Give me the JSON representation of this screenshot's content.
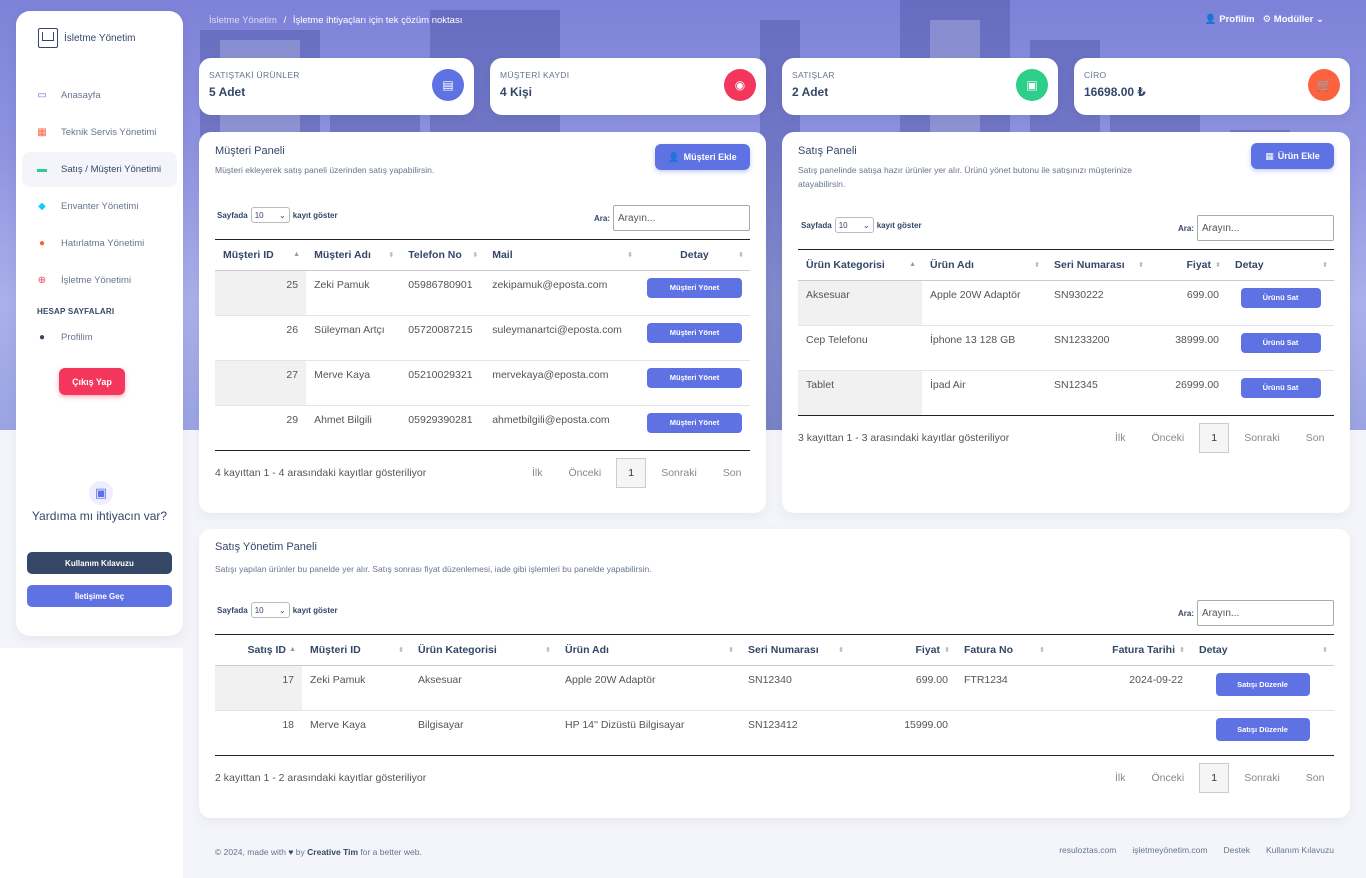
{
  "sidebar": {
    "brand": "İsletme Yönetim",
    "items": [
      {
        "label": "Anasayfa",
        "icon": "monitor-icon"
      },
      {
        "label": "Teknik Servis Yönetimi",
        "icon": "calendar-icon"
      },
      {
        "label": "Satış / Müşteri Yönetimi",
        "icon": "credit-card-icon"
      },
      {
        "label": "Envanter Yönetimi",
        "icon": "box-icon"
      },
      {
        "label": "Hatırlatma Yönetimi",
        "icon": "bell-icon"
      },
      {
        "label": "İşletme Yönetimi",
        "icon": "globe-icon"
      }
    ],
    "section_heading": "HESAP SAYFALARI",
    "profile_item": "Profilim",
    "logout": "Çıkış Yap",
    "help_title": "Yardıma mı ihtiyacın var?",
    "guide_button": "Kullanım Kılavuzu",
    "contact_button": "İletişime Geç"
  },
  "topbar": {
    "crumb_root": "İsletme Yönetim",
    "crumb_sep": "/",
    "crumb_current": "İşletme ihtiyaçları için tek çözüm noktası",
    "profile": "Profilim",
    "modules": "Modüller"
  },
  "stats": [
    {
      "label": "SATIŞTAKİ ÜRÜNLER",
      "value": "5 Adet",
      "color": "#5e72e4"
    },
    {
      "label": "MÜŞTERİ KAYDI",
      "value": "4 Kişi",
      "color": "#f5365c"
    },
    {
      "label": "SATIŞLAR",
      "value": "2 Adet",
      "color": "#2dce89"
    },
    {
      "label": "CİRO",
      "value": "16698.00 ₺",
      "color": "#fb6340"
    }
  ],
  "customer_panel": {
    "title": "Müşteri Paneli",
    "desc": "Müşteri ekleyerek satış paneli üzerinden satış yapabilirsin.",
    "add_button": "Müşteri Ekle",
    "length_prefix": "Sayfada",
    "length_value": "10",
    "length_suffix": "kayıt göster",
    "search_label": "Ara:",
    "search_placeholder": "Arayın...",
    "columns": [
      "Müşteri ID",
      "Müşteri Adı",
      "Telefon No",
      "Mail",
      "Detay"
    ],
    "rows": [
      {
        "id": "25",
        "name": "Zeki Pamuk",
        "phone": "05986780901",
        "mail": "zekipamuk@eposta.com",
        "action": "Müşteri Yönet"
      },
      {
        "id": "26",
        "name": "Süleyman Artçı",
        "phone": "05720087215",
        "mail": "suleymanartci@eposta.com",
        "action": "Müşteri Yönet"
      },
      {
        "id": "27",
        "name": "Merve Kaya",
        "phone": "05210029321",
        "mail": "mervekaya@eposta.com",
        "action": "Müşteri Yönet"
      },
      {
        "id": "29",
        "name": "Ahmet Bilgili",
        "phone": "05929390281",
        "mail": "ahmetbilgili@eposta.com",
        "action": "Müşteri Yönet"
      }
    ],
    "info": "4 kayıttan 1 - 4 arasındaki kayıtlar gösteriliyor",
    "pager": {
      "first": "İlk",
      "prev": "Önceki",
      "current": "1",
      "next": "Sonraki",
      "last": "Son"
    }
  },
  "sales_panel": {
    "title": "Satış Paneli",
    "desc": "Satış panelinde satışa hazır ürünler yer alır. Ürünü yönet butonu ile satışınızı müşterinize atayabilirsin.",
    "add_button": "Ürün Ekle",
    "length_prefix": "Sayfada",
    "length_value": "10",
    "length_suffix": "kayıt göster",
    "search_label": "Ara:",
    "search_placeholder": "Arayın...",
    "columns": [
      "Ürün Kategorisi",
      "Ürün Adı",
      "Seri Numarası",
      "Fiyat",
      "Detay"
    ],
    "rows": [
      {
        "category": "Aksesuar",
        "name": "Apple 20W Adaptör",
        "serial": "SN930222",
        "price": "699.00",
        "action": "Ürünü Sat"
      },
      {
        "category": "Cep Telefonu",
        "name": "İphone 13 128 GB",
        "serial": "SN1233200",
        "price": "38999.00",
        "action": "Ürünü Sat"
      },
      {
        "category": "Tablet",
        "name": "İpad Air",
        "serial": "SN12345",
        "price": "26999.00",
        "action": "Ürünü Sat"
      }
    ],
    "info": "3 kayıttan 1 - 3 arasındaki kayıtlar gösteriliyor",
    "pager": {
      "first": "İlk",
      "prev": "Önceki",
      "current": "1",
      "next": "Sonraki",
      "last": "Son"
    }
  },
  "management_panel": {
    "title": "Satış Yönetim Paneli",
    "desc": "Satışı yapılan ürünler bu panelde yer alır. Satış sonrası fiyat düzenlemesi, iade gibi işlemleri bu panelde yapabilirsin.",
    "length_prefix": "Sayfada",
    "length_value": "10",
    "length_suffix": "kayıt göster",
    "search_label": "Ara:",
    "search_placeholder": "Arayın...",
    "columns": [
      "Satış ID",
      "Müşteri ID",
      "Ürün Kategorisi",
      "Ürün Adı",
      "Seri Numarası",
      "Fiyat",
      "Fatura No",
      "Fatura Tarihi",
      "Detay"
    ],
    "rows": [
      {
        "id": "17",
        "customer": "Zeki Pamuk",
        "category": "Aksesuar",
        "name": "Apple 20W Adaptör",
        "serial": "SN12340",
        "price": "699.00",
        "invoice": "FTR1234",
        "date": "2024-09-22",
        "action": "Satışı Düzenle"
      },
      {
        "id": "18",
        "customer": "Merve Kaya",
        "category": "Bilgisayar",
        "name": "HP 14'' Dizüstü Bilgisayar",
        "serial": "SN123412",
        "price": "15999.00",
        "invoice": "",
        "date": "",
        "action": "Satışı Düzenle"
      }
    ],
    "info": "2 kayıttan 1 - 2 arasındaki kayıtlar gösteriliyor",
    "pager": {
      "first": "İlk",
      "prev": "Önceki",
      "current": "1",
      "next": "Sonraki",
      "last": "Son"
    }
  },
  "footer": {
    "prefix": "© 2024, made with",
    "by": "by",
    "author": "Creative Tim",
    "suffix": "for a better web.",
    "links": [
      "resuloztas.com",
      "işletmeyönetim.com",
      "Destek",
      "Kullanım Kılavuzu"
    ]
  }
}
